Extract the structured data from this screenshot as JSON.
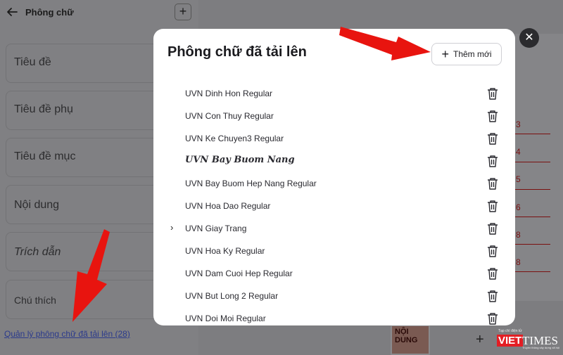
{
  "left_panel": {
    "title": "Phông chữ",
    "add_label": "+",
    "styles": [
      "Tiêu đề",
      "Tiêu đề phụ",
      "Tiêu đề mục",
      "Nội dung",
      "Trích dẫn",
      "Chú thích"
    ],
    "manage_link": "Quản lý phông chữ đã tải lên (28)"
  },
  "background": {
    "numbers": [
      "3",
      "4",
      "5",
      "6",
      "8",
      "8"
    ],
    "thumb_text": "NỘI DUNG",
    "plus": "+",
    "brand_top": "Tạp chí điện tử",
    "brand_viet": "VIET",
    "brand_times": "TIMES",
    "brand_sub": "Truyền thông xây dựng xã hội"
  },
  "modal": {
    "title": "Phông chữ đã tải lên",
    "add_new_label": "Thêm mới",
    "fonts": [
      "UVN Dinh Hon Regular",
      "UVN Con Thuy Regular",
      "UVN Ke Chuyen3 Regular",
      "UVN Bay Buom Nang",
      "UVN Bay Buom Hep Nang Regular",
      "UVN Hoa Dao Regular",
      "UVN Giay Trang",
      "UVN Hoa Ky Regular",
      "UVN Dam Cuoi Hep Regular",
      "UVN But Long 2 Regular",
      "UVN Doi Moi Regular"
    ]
  },
  "close_label": "✕",
  "colors": {
    "arrow": "#e8140f",
    "link": "#2b3a8c"
  }
}
